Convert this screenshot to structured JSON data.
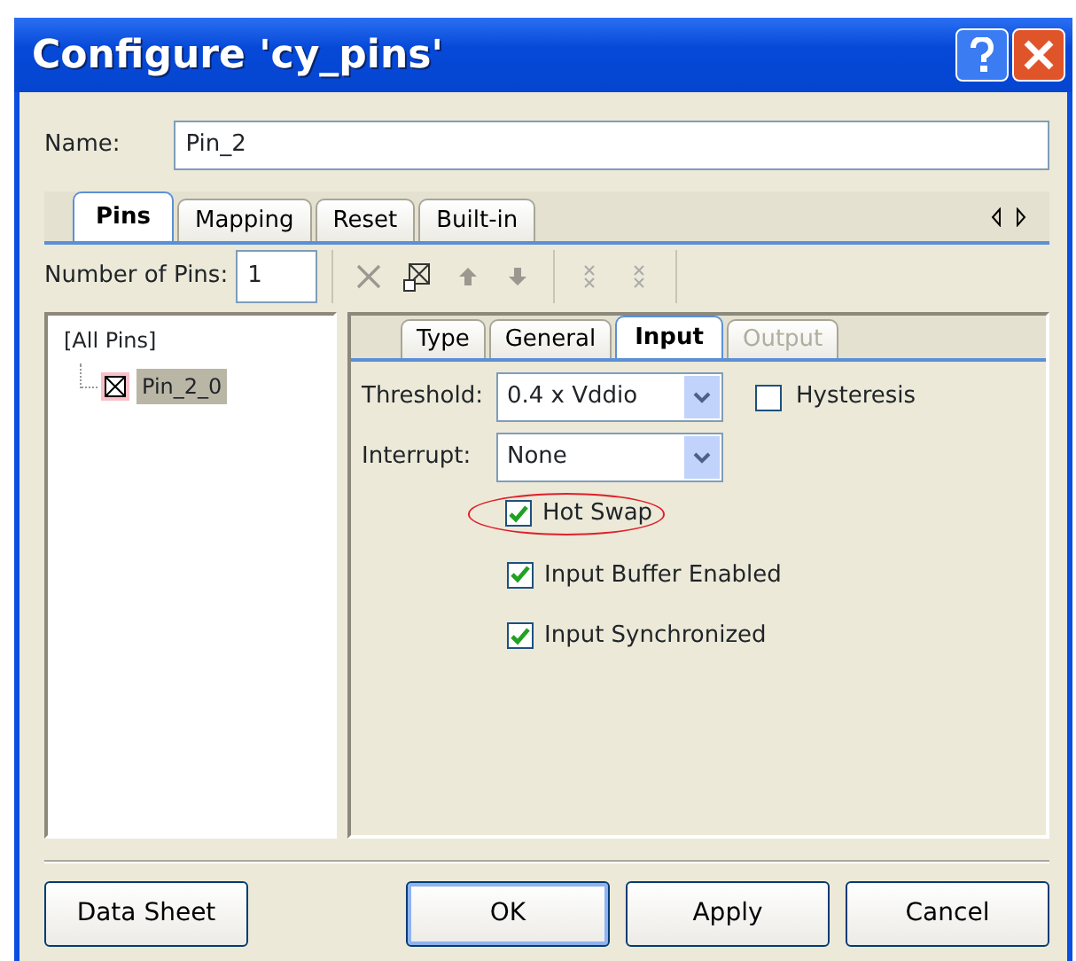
{
  "window": {
    "title": "Configure 'cy_pins'"
  },
  "name_field": {
    "label": "Name:",
    "value": "Pin_2"
  },
  "tabs": [
    {
      "label": "Pins",
      "selected": true
    },
    {
      "label": "Mapping",
      "selected": false
    },
    {
      "label": "Reset",
      "selected": false
    },
    {
      "label": "Built-in",
      "selected": false
    }
  ],
  "pin_count": {
    "label": "Number of Pins:",
    "value": "1"
  },
  "tree": [
    {
      "label": "[All Pins]",
      "selected": false,
      "children": [
        {
          "label": "Pin_2_0",
          "selected": true
        }
      ]
    }
  ],
  "subtabs": [
    {
      "label": "Type",
      "selected": false,
      "disabled": false
    },
    {
      "label": "General",
      "selected": false,
      "disabled": false
    },
    {
      "label": "Input",
      "selected": true,
      "disabled": false
    },
    {
      "label": "Output",
      "selected": false,
      "disabled": true
    }
  ],
  "threshold": {
    "label": "Threshold:",
    "value": "0.4 x Vddio"
  },
  "hysteresis": {
    "label": "Hysteresis",
    "checked": false
  },
  "interrupt": {
    "label": "Interrupt:",
    "value": "None"
  },
  "options": [
    {
      "label": "Hot Swap",
      "checked": true,
      "highlighted": true
    },
    {
      "label": "Input Buffer Enabled",
      "checked": true,
      "highlighted": false
    },
    {
      "label": "Input Synchronized",
      "checked": true,
      "highlighted": false
    }
  ],
  "buttons": [
    {
      "label": "Data Sheet",
      "default": false
    },
    {
      "label": "OK",
      "default": true
    },
    {
      "label": "Apply",
      "default": false
    },
    {
      "label": "Cancel",
      "default": false
    }
  ]
}
